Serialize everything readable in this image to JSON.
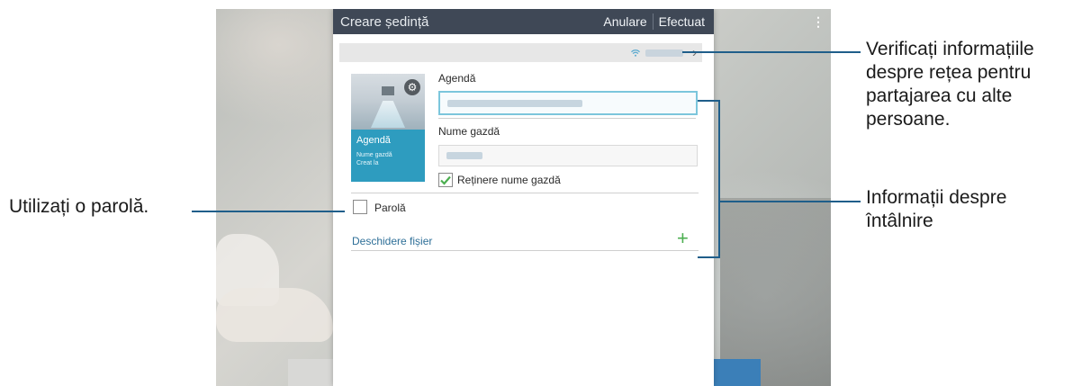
{
  "window": {
    "title": "Creare ședință",
    "actions": {
      "cancel": "Anulare",
      "done": "Efectuat"
    }
  },
  "meeting": {
    "agenda_label": "Agendă",
    "host_label": "Nume gazdă",
    "remember_host_label": "Reținere nume gazdă",
    "remember_host_checked": true,
    "password_label": "Parolă",
    "password_checked": false,
    "open_file_label": "Deschidere fișier"
  },
  "thumbnail": {
    "title": "Agendă",
    "line1": "Nume gazdă",
    "line2": "Creat la"
  },
  "callouts": {
    "network_info": [
      "Verificați informațiile",
      "despre rețea pentru",
      "partajarea cu alte",
      "persoane."
    ],
    "meeting_info": [
      "Informații despre",
      "întâlnire"
    ],
    "password": "Utilizați o parolă."
  },
  "colors": {
    "action_bar": "#3f4856",
    "accent_check": "#4caf50",
    "callout_line": "#1f5e8a",
    "thumbnail_bg": "#2e9cbf"
  },
  "icons": [
    "wifi-icon",
    "chevron-right-icon",
    "gear-icon",
    "plus-icon",
    "overflow-menu-icon",
    "check-icon"
  ]
}
